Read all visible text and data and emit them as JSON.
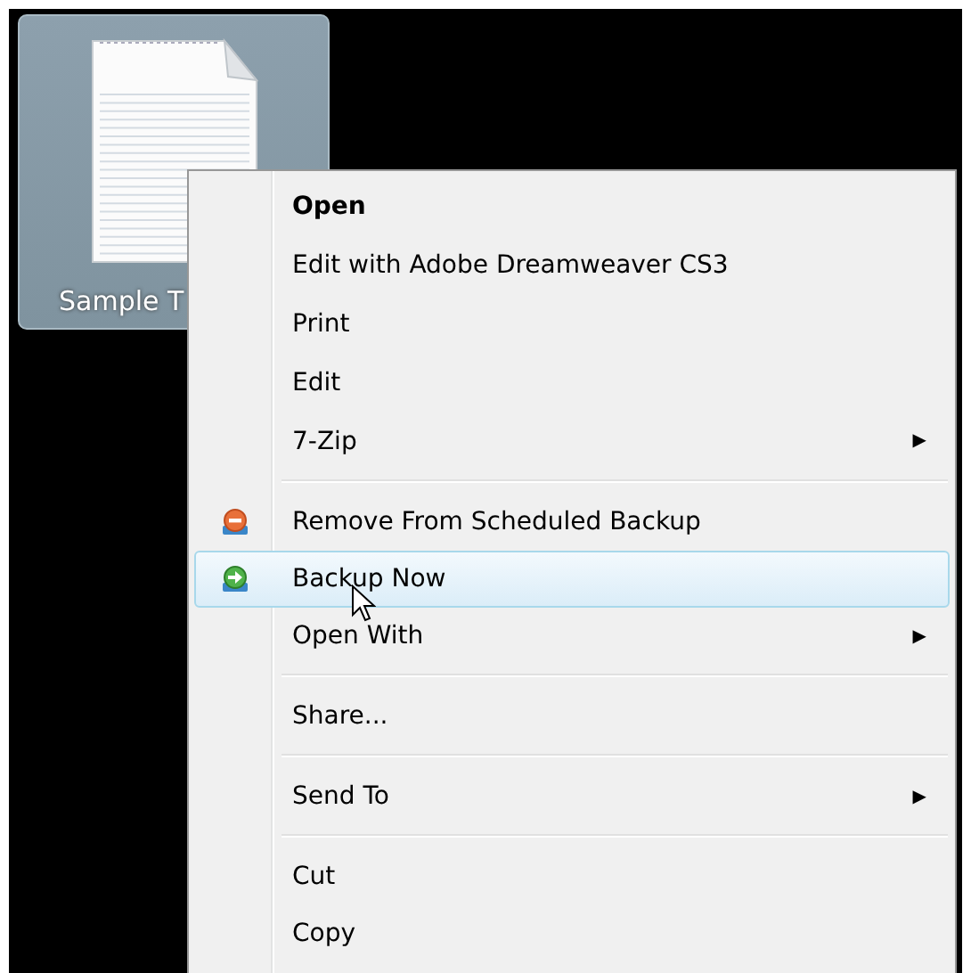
{
  "desktop_icon": {
    "label": "Sample T",
    "selected": true
  },
  "context_menu": {
    "groups": [
      [
        {
          "kind": "default",
          "label": "Open",
          "selected": false
        },
        {
          "kind": "plain",
          "label": "Edit with Adobe Dreamweaver CS3",
          "selected": false
        },
        {
          "kind": "plain",
          "label": "Print",
          "selected": false
        },
        {
          "kind": "plain",
          "label": "Edit",
          "selected": false
        },
        {
          "kind": "submenu",
          "label": "7-Zip",
          "selected": false,
          "arrow": "▶"
        }
      ],
      [
        {
          "kind": "backup-remove",
          "label": "Remove From Scheduled Backup",
          "selected": false
        },
        {
          "kind": "backup-now",
          "label": "Backup Now",
          "selected": true
        },
        {
          "kind": "submenu",
          "label": "Open With",
          "selected": false,
          "arrow": "▶"
        }
      ],
      [
        {
          "kind": "plain",
          "label": "Share...",
          "selected": false
        }
      ],
      [
        {
          "kind": "submenu",
          "label": "Send To",
          "selected": false,
          "arrow": "▶"
        }
      ],
      [
        {
          "kind": "plain",
          "label": "Cut",
          "selected": false
        },
        {
          "kind": "plain",
          "label": "Copy",
          "selected": false
        }
      ]
    ]
  }
}
